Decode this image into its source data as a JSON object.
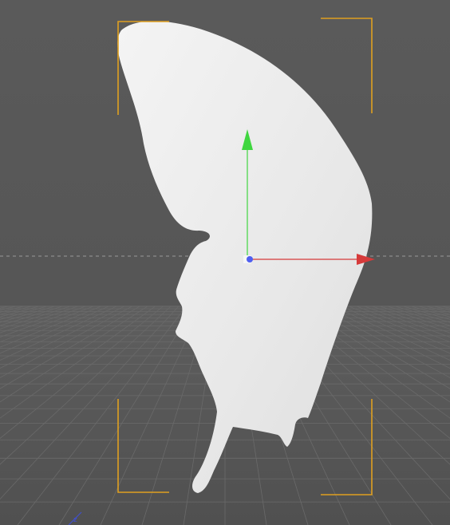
{
  "viewport": {
    "view": "perspective",
    "background_color": "#585858",
    "grid_color": "#6a6a6a",
    "horizon_line_color": "#9a9a9a",
    "corner_bracket_color": "#e0a020"
  },
  "object": {
    "shape": "butterfly-wing",
    "fill_color": "#ececec",
    "selected": true
  },
  "gizmo": {
    "type": "move",
    "axes": [
      {
        "name": "x",
        "color": "#d63a3a"
      },
      {
        "name": "y",
        "color": "#3fd63f"
      },
      {
        "name": "z",
        "color": "#4f5ff0"
      }
    ]
  },
  "world_axis_indicator": {
    "label": "z",
    "color": "#3f4fd6"
  }
}
